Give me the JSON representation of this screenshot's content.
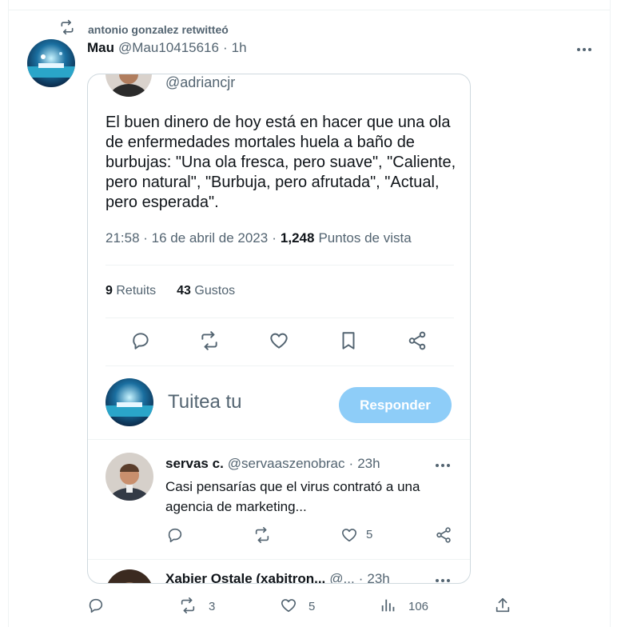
{
  "retweet": {
    "label": "antonio gonzalez retwitteó"
  },
  "tweet": {
    "name": "Mau",
    "handle": "@Mau10415616",
    "separator": "·",
    "time": "1h"
  },
  "quote": {
    "handle": "@adriancjr",
    "text": "El buen dinero de hoy está en hacer que una ola de enfermedades mortales huela a baño de burbujas: \"Una ola fresca, pero suave\", \"Caliente, pero natural\", \"Burbuja, pero afrutada\", \"Actual, pero esperada\".",
    "timestamp": "21:58 · 16 de abril de 2023",
    "meta_sep": "·",
    "views_count": "1,248",
    "views_label": "Puntos de vista",
    "retweets_count": "9",
    "retweets_label": "Retuits",
    "likes_count": "43",
    "likes_label": "Gustos"
  },
  "composer": {
    "placeholder": "Tuitea tu",
    "button": "Responder"
  },
  "replies": [
    {
      "name": "servas c.",
      "handle": "@servaaszenobrac",
      "sep": "·",
      "time": "23h",
      "text": "Casi pensarías que el virus contrató a una agencia de marketing...",
      "likes": "5"
    },
    {
      "name": "Xabier Ostale (xabitron...",
      "handle": "@...",
      "sep": "·",
      "time": "23h"
    }
  ],
  "bottom": {
    "retweets": "3",
    "likes": "5",
    "views": "106"
  },
  "icons": {
    "retweet": "retweet-icon",
    "reply": "reply-icon",
    "like": "heart-icon",
    "bookmark": "bookmark-icon",
    "share": "share-icon",
    "views": "views-icon",
    "more": "more-icon",
    "upload": "upload-icon"
  },
  "colors": {
    "accent": "#1d9bf0",
    "button_disabled": "#8ecdf8",
    "muted_text": "#536471",
    "text": "#0f1419",
    "border": "#cfd9de"
  }
}
